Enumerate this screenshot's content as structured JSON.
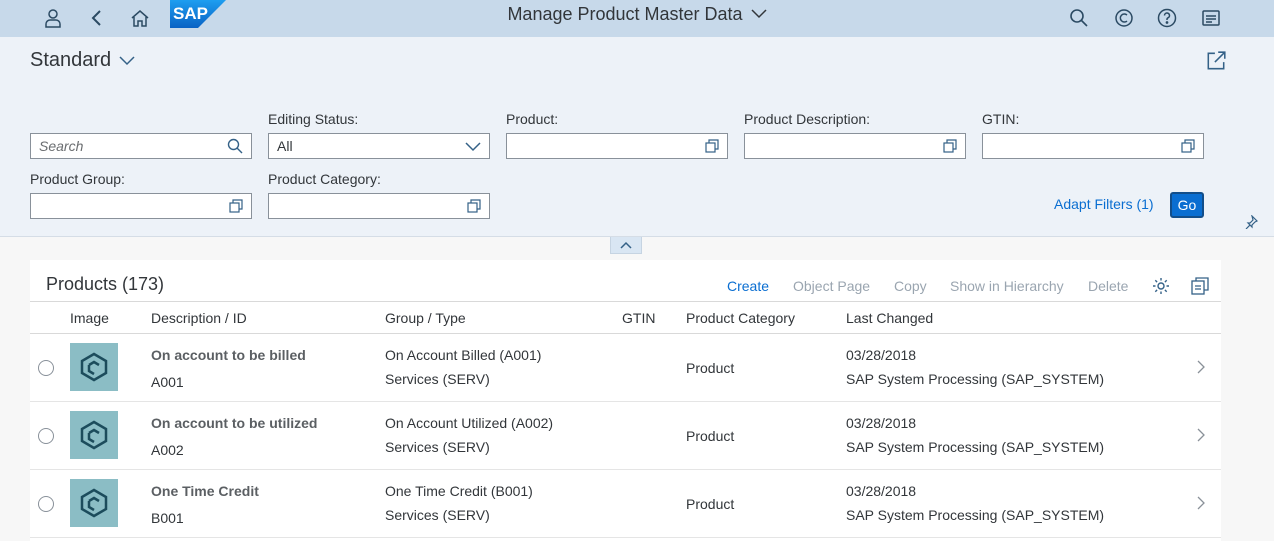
{
  "shell": {
    "title": "Manage Product Master Data",
    "logo_text": "SAP",
    "icons": [
      "user-icon",
      "back-icon",
      "home-icon",
      "search-icon",
      "copilot-icon",
      "help-icon",
      "notifications-icon"
    ]
  },
  "header": {
    "variant": "Standard",
    "filters": {
      "search_placeholder": "Search",
      "editing_status_label": "Editing Status:",
      "editing_status_value": "All",
      "product_label": "Product:",
      "product_description_label": "Product Description:",
      "gtin_label": "GTIN:",
      "product_group_label": "Product Group:",
      "product_category_label": "Product Category:"
    },
    "adapt_filters": "Adapt Filters (1)",
    "go": "Go"
  },
  "table": {
    "title": "Products (173)",
    "actions": {
      "create": "Create",
      "object_page": "Object Page",
      "copy": "Copy",
      "show_in_hierarchy": "Show in Hierarchy",
      "delete": "Delete"
    },
    "columns": [
      "Image",
      "Description / ID",
      "Group / Type",
      "GTIN",
      "Product Category",
      "Last Changed"
    ],
    "rows": [
      {
        "description": "On account to be billed",
        "id": "A001",
        "group": "On Account Billed (A001)",
        "type": "Services (SERV)",
        "gtin": "",
        "category": "Product",
        "date": "03/28/2018",
        "changed_by": "SAP System Processing (SAP_SYSTEM)"
      },
      {
        "description": "On account to be utilized",
        "id": "A002",
        "group": "On Account Utilized (A002)",
        "type": "Services (SERV)",
        "gtin": "",
        "category": "Product",
        "date": "03/28/2018",
        "changed_by": "SAP System Processing (SAP_SYSTEM)"
      },
      {
        "description": "One Time Credit",
        "id": "B001",
        "group": "One Time Credit (B001)",
        "type": "Services (SERV)",
        "gtin": "",
        "category": "Product",
        "date": "03/28/2018",
        "changed_by": "SAP System Processing (SAP_SYSTEM)"
      }
    ]
  },
  "colors": {
    "shell_bg": "#c7d9ea",
    "header_bg": "#edf2f8",
    "accent": "#0a6ed1",
    "thumb_bg": "#8bbdc5"
  }
}
